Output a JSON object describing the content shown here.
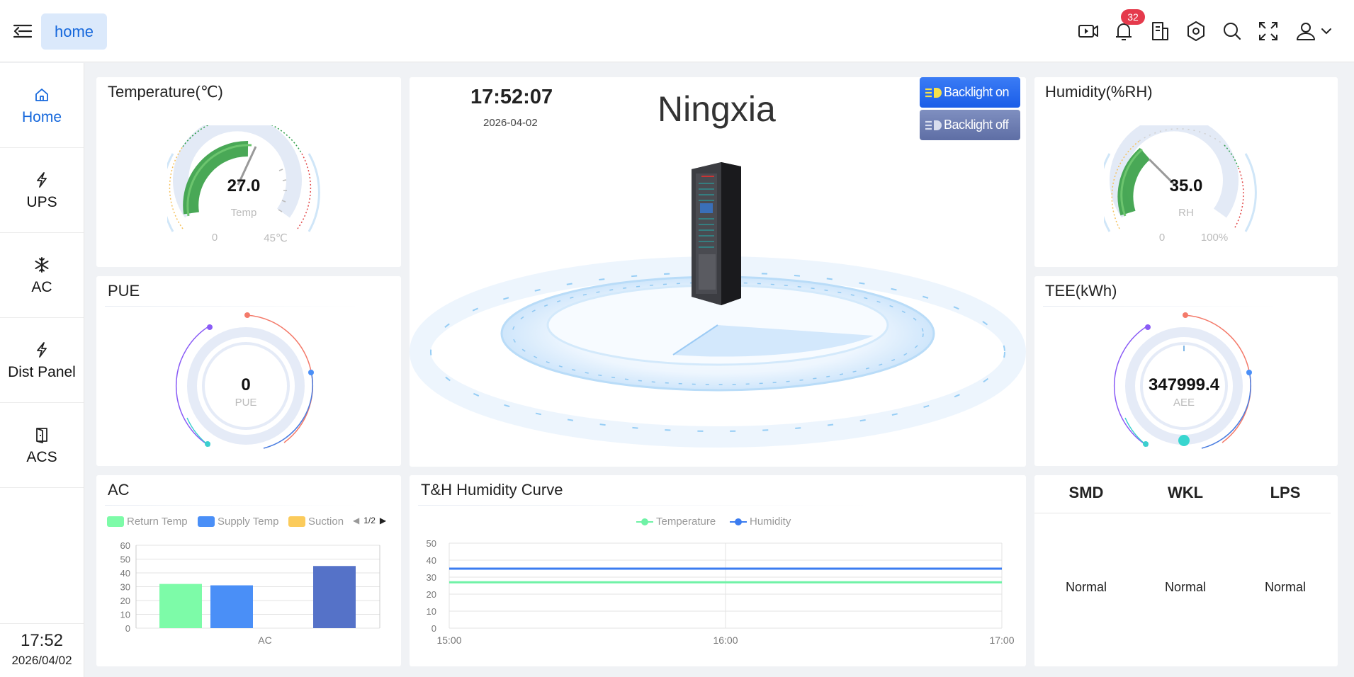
{
  "topbar": {
    "home_tab": "home",
    "notification_count": "32",
    "icons": [
      "menu-fold-icon",
      "video-icon",
      "bell-icon",
      "report-icon",
      "settings-icon",
      "search-icon",
      "fullscreen-icon",
      "user-icon",
      "chevron-down-icon"
    ]
  },
  "sidebar": {
    "items": [
      {
        "label": "Home",
        "icon": "home-icon",
        "active": true
      },
      {
        "label": "UPS",
        "icon": "lightning-icon",
        "active": false
      },
      {
        "label": "AC",
        "icon": "snowflake-icon",
        "active": false
      },
      {
        "label": "Dist Panel",
        "icon": "lightning-icon",
        "active": false
      },
      {
        "label": "ACS",
        "icon": "door-icon",
        "active": false
      }
    ],
    "time": "17:52",
    "date": "2026/04/02"
  },
  "temperature": {
    "title": "Temperature(℃)",
    "value": "27.0",
    "sub": "Temp",
    "min": "0",
    "max": "45℃",
    "fraction": 0.6
  },
  "humidity": {
    "title": "Humidity(%RH)",
    "value": "35.0",
    "sub": "RH",
    "min": "0",
    "max": "100%",
    "fraction": 0.35
  },
  "pue": {
    "title": "PUE",
    "value": "0",
    "sub": "PUE"
  },
  "tee": {
    "title": "TEE(kWh)",
    "value": "347999.4",
    "sub": "AEE"
  },
  "center": {
    "time": "17:52:07",
    "date": "2026-04-02",
    "site": "Ningxia",
    "backlight_on": "Backlight on",
    "backlight_off": "Backlight off"
  },
  "ac_chart": {
    "title": "AC",
    "pager": "1/2",
    "chart_data": {
      "type": "bar",
      "categories": [
        "AC"
      ],
      "series": [
        {
          "name": "Return Temp",
          "values": [
            32
          ],
          "color": "#7dfba8"
        },
        {
          "name": "Supply Temp",
          "values": [
            31
          ],
          "color": "#4a8ff7"
        },
        {
          "name": "Suction",
          "values": [
            null
          ],
          "color": "#fbcb5b"
        },
        {
          "name": "",
          "values": [
            45
          ],
          "color": "#5572c8"
        }
      ],
      "yticks": [
        "60",
        "50",
        "40",
        "30",
        "20",
        "10",
        "0"
      ],
      "ylim": [
        0,
        60
      ],
      "xlabel": "AC"
    }
  },
  "th_chart": {
    "title": "T&H Humidity Curve",
    "chart_data": {
      "type": "line",
      "x": [
        "15:00",
        "16:00",
        "17:00"
      ],
      "series": [
        {
          "name": "Temperature",
          "values": [
            27,
            27,
            27
          ],
          "color": "#6ff2a6"
        },
        {
          "name": "Humidity",
          "values": [
            35,
            35,
            35
          ],
          "color": "#3b7cf0"
        }
      ],
      "yticks": [
        "50",
        "40",
        "30",
        "20",
        "10",
        "0"
      ],
      "ylim": [
        0,
        50
      ]
    }
  },
  "status": {
    "headers": [
      "SMD",
      "WKL",
      "LPS"
    ],
    "values": [
      "Normal",
      "Normal",
      "Normal"
    ]
  }
}
